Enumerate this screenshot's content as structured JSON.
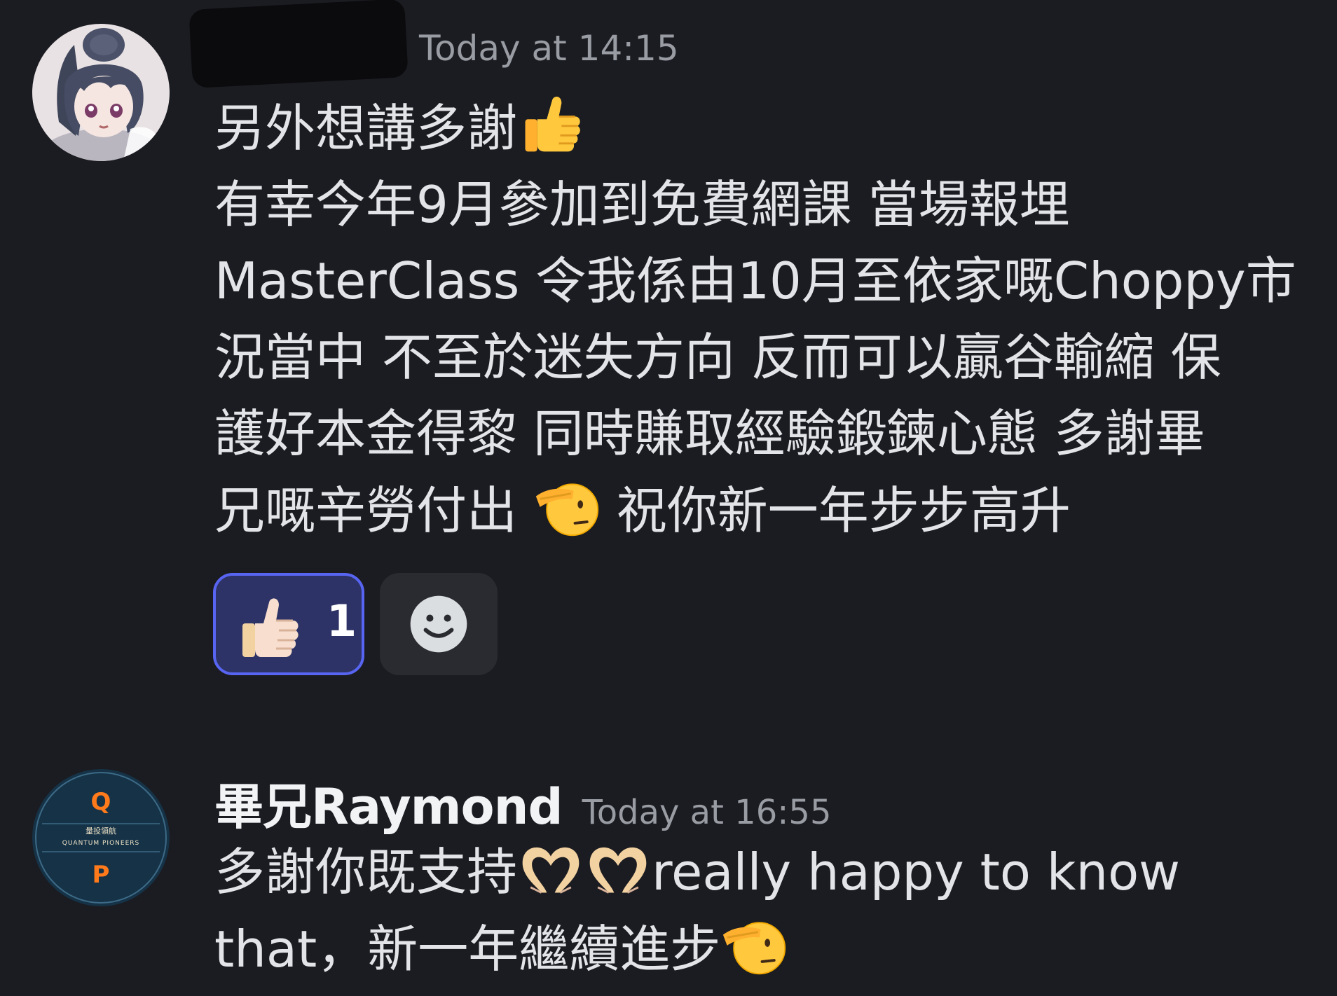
{
  "messages": [
    {
      "timestamp": "Today at 14:15",
      "lines": [
        "另外想講多謝",
        "有幸今年9月參加到免費網課 當場報埋",
        "MasterClass 令我係由10月至依家嘅Choppy市",
        "況當中 不至於迷失方向 反而可以贏谷輸縮 保",
        "護好本金得黎 同時賺取經驗鍛鍊心態 多謝畢",
        "兄嘅辛勞付出",
        "祝你新一年步步高升"
      ],
      "emojis": [
        "thumbs-up",
        "saluting-face"
      ],
      "reactions": [
        {
          "emoji": "thumbs-up-light-skin",
          "count": "1",
          "active": true
        },
        {
          "emoji": "add-reaction-smiley",
          "count": null,
          "active": false
        }
      ]
    },
    {
      "username": "畢兄Raymond",
      "timestamp": "Today at 16:55",
      "lines": [
        "多謝你既支持",
        "really happy to know",
        "that，新一年繼續進步"
      ],
      "emojis": [
        "heart-hands",
        "heart-hands",
        "saluting-face"
      ],
      "avatar": {
        "letter_top": "Q",
        "letter_bottom": "P",
        "chinese": "量投領航",
        "ring_text": "QUANTUM PIONEERS"
      }
    }
  ],
  "colors": {
    "background": "#1b1c21",
    "text": "#e3e4e8",
    "timestamp": "#9a9ca4",
    "reaction_active_bg": "#2d3366",
    "reaction_active_border": "#5865f2",
    "logo_bg": "#153247",
    "logo_accent": "#ff7a1a"
  }
}
